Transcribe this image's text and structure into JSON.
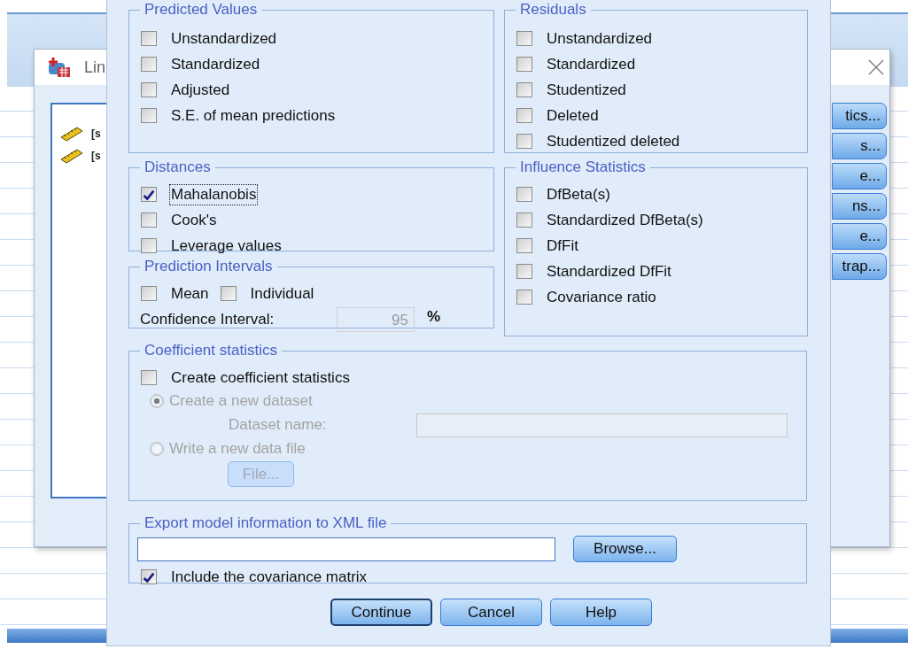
{
  "background_window": {
    "title": "Lin",
    "variables": [
      {
        "label": "[s"
      },
      {
        "label": "[s"
      }
    ],
    "buttons": [
      "tics...",
      "s...",
      "e...",
      "ns...",
      "e...",
      "trap..."
    ]
  },
  "dialog": {
    "predicted_values": {
      "title": "Predicted Values",
      "options": [
        {
          "label": "Unstandardized",
          "checked": false
        },
        {
          "label": "Standardized",
          "checked": false
        },
        {
          "label": "Adjusted",
          "checked": false
        },
        {
          "label": "S.E. of mean predictions",
          "checked": false
        }
      ]
    },
    "residuals": {
      "title": "Residuals",
      "options": [
        {
          "label": "Unstandardized",
          "checked": false
        },
        {
          "label": "Standardized",
          "checked": false
        },
        {
          "label": "Studentized",
          "checked": false
        },
        {
          "label": "Deleted",
          "checked": false
        },
        {
          "label": "Studentized deleted",
          "checked": false
        }
      ]
    },
    "distances": {
      "title": "Distances",
      "options": [
        {
          "label": "Mahalanobis",
          "checked": true,
          "focused": true
        },
        {
          "label": "Cook's",
          "checked": false,
          "focused": false
        },
        {
          "label": "Leverage values",
          "checked": false,
          "focused": false
        }
      ]
    },
    "influence_statistics": {
      "title": "Influence Statistics",
      "options": [
        {
          "label": "DfBeta(s)",
          "checked": false
        },
        {
          "label": "Standardized DfBeta(s)",
          "checked": false
        },
        {
          "label": "DfFit",
          "checked": false
        },
        {
          "label": "Standardized DfFit",
          "checked": false
        },
        {
          "label": "Covariance ratio",
          "checked": false
        }
      ]
    },
    "prediction_intervals": {
      "title": "Prediction Intervals",
      "options": [
        {
          "label": "Mean",
          "checked": false
        },
        {
          "label": "Individual",
          "checked": false
        }
      ],
      "confidence_label": "Confidence Interval:",
      "confidence_value": "95",
      "confidence_disabled": true,
      "unit": "%"
    },
    "coefficient_statistics": {
      "title": "Coefficient statistics",
      "create": {
        "label": "Create coefficient statistics",
        "checked": false
      },
      "disabled": true,
      "choices": [
        {
          "label": "Create a new dataset",
          "selected": true
        },
        {
          "label": "Write a new data file",
          "selected": false
        }
      ],
      "dataset_name_label": "Dataset name:",
      "file_button": "File..."
    },
    "export": {
      "title": "Export model information to XML file",
      "browse_button": "Browse...",
      "include": {
        "label": "Include the covariance matrix",
        "checked": true
      }
    },
    "buttons": [
      {
        "label": "Continue",
        "default": true
      },
      {
        "label": "Cancel",
        "default": false
      },
      {
        "label": "Help",
        "default": false
      }
    ]
  }
}
